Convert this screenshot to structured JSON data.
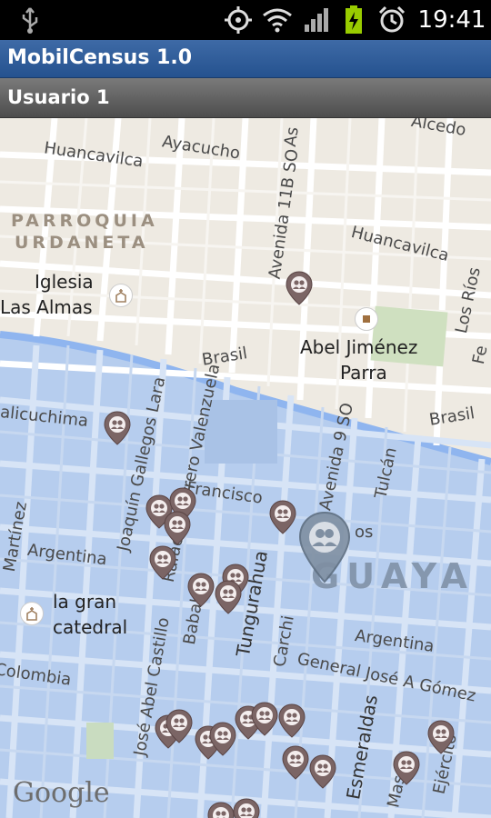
{
  "status_bar": {
    "time": "19:41",
    "icons": [
      "usb-icon",
      "gps-icon",
      "wifi-icon",
      "signal-icon",
      "battery-charging-icon",
      "alarm-icon"
    ]
  },
  "app": {
    "title": "MobilCensus 1.0",
    "subtitle": "Usuario 1"
  },
  "map": {
    "streets": {
      "alcedo": "Alcedo",
      "huancavilca_1": "Huancavilca",
      "ayacucho": "Ayacucho",
      "avenida_11b": "Avenida 11B SO",
      "as": "As",
      "huancavilca_2": "Huancavilca",
      "los_rios": "Los Ríos",
      "fe": "Fe",
      "brasil_1": "Brasil",
      "brasil_2": "Brasil",
      "gallegos": "Joaquín Gallegos Lara",
      "guerrero": "Rafael Guerrero Valenzuela",
      "calicuchima": "alicuchima",
      "martinez": "Martínez",
      "argentina_1": "Argentina",
      "francisco": "Francisco",
      "av9": "Avenida 9 SO",
      "tulcan": "Tulcán",
      "tungurahua": "Tungurahua",
      "babahoyo": "Babaho",
      "carchi": "Carchi",
      "argentina_2": "Argentina",
      "general": "General José A Gómez",
      "colombia": "Colombia",
      "castillo": "José Abel Castillo",
      "esmeraldas": "Esmeraldas",
      "mascote": "Masco",
      "ejercito": "Ejército",
      "os": "os"
    },
    "parroquia_line1": "PARROQUIA",
    "parroquia_line2": "URDANETA",
    "iglesia_line1": "Iglesia",
    "iglesia_line2": "Las Almas",
    "abel_line1": "Abel Jiménez",
    "abel_line2": "Parra",
    "gran_line1": "la gran",
    "gran_line2": "catedral",
    "guayaquil": "GUAYA",
    "google": "Google",
    "colors": {
      "land": "#eeeae2",
      "water_area": "#b6cdee",
      "river": "#8fb5ef",
      "road": "#ffffff",
      "park": "#cfe0c0",
      "pin": "#7b6565"
    }
  }
}
